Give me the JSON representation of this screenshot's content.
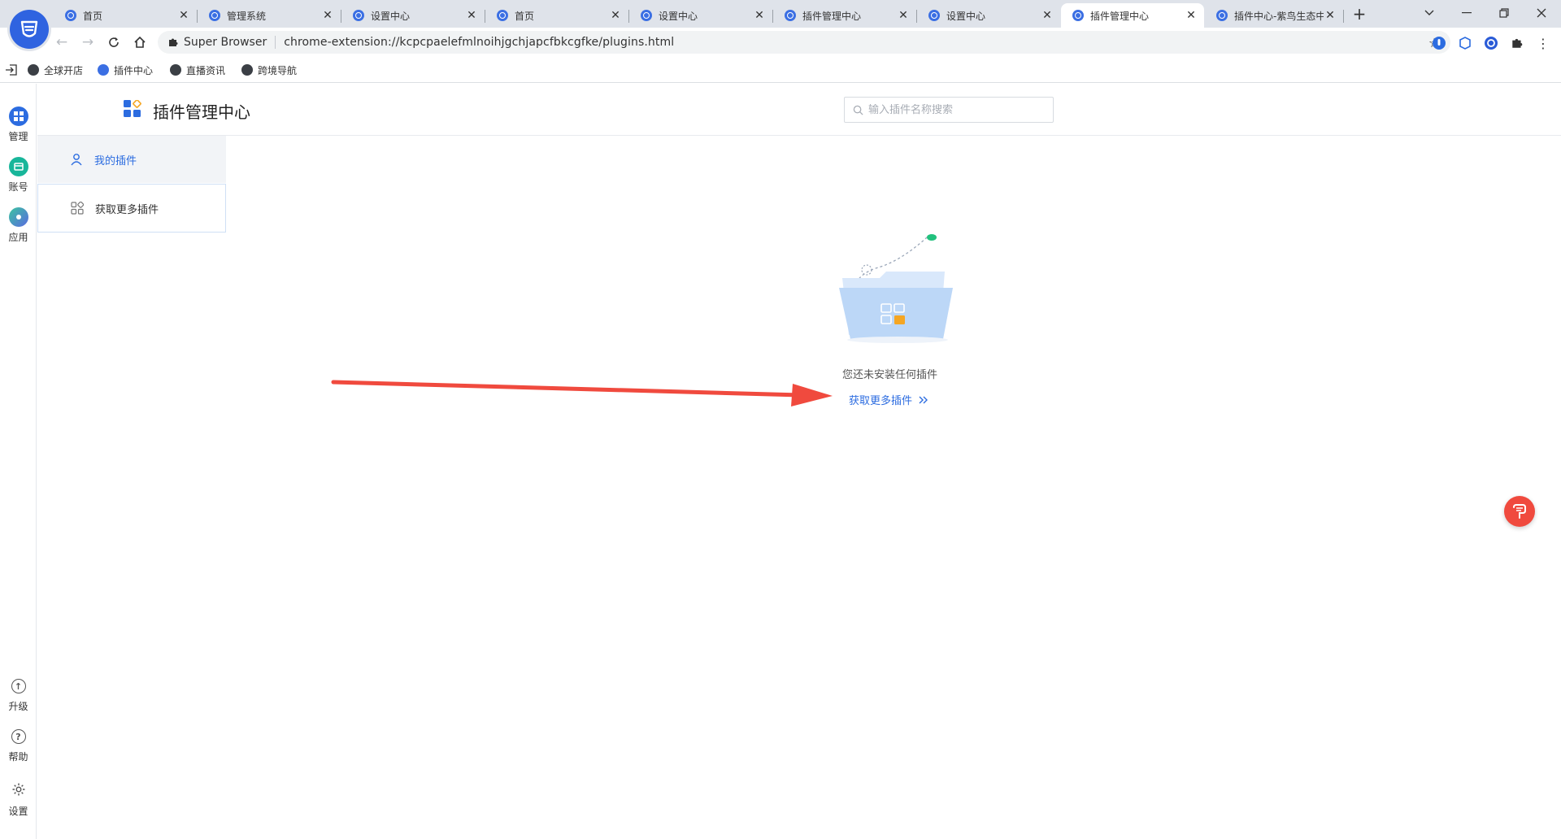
{
  "tabs": [
    {
      "label": "首页",
      "active": false
    },
    {
      "label": "管理系统",
      "active": false
    },
    {
      "label": "设置中心",
      "active": false
    },
    {
      "label": "首页",
      "active": false
    },
    {
      "label": "设置中心",
      "active": false
    },
    {
      "label": "插件管理中心",
      "active": false
    },
    {
      "label": "设置中心",
      "active": false
    },
    {
      "label": "插件管理中心",
      "active": true
    },
    {
      "label": "插件中心-紫鸟生态中",
      "active": false
    }
  ],
  "addressbar": {
    "chip": "Super Browser",
    "url": "chrome-extension://kcpcpaelefmlnoihjgchjapcfbkcgfke/plugins.html"
  },
  "bookmarks": [
    {
      "label": "全球开店"
    },
    {
      "label": "插件中心"
    },
    {
      "label": "直播资讯"
    },
    {
      "label": "跨境导航"
    }
  ],
  "rail": {
    "top": [
      {
        "label": "管理"
      },
      {
        "label": "账号"
      },
      {
        "label": "应用"
      }
    ],
    "bottom": [
      {
        "label": "升级"
      },
      {
        "label": "帮助"
      },
      {
        "label": "设置"
      }
    ]
  },
  "header": {
    "title": "插件管理中心",
    "search_placeholder": "输入插件名称搜索"
  },
  "menu": [
    {
      "label": "我的插件",
      "active": true
    },
    {
      "label": "获取更多插件",
      "active": false
    }
  ],
  "empty": {
    "message": "您还未安装任何插件",
    "link": "获取更多插件"
  },
  "colors": {
    "accent": "#2c6ce0",
    "annotation_arrow": "#f04a3e",
    "tabstrip": "#dfe3ea"
  }
}
